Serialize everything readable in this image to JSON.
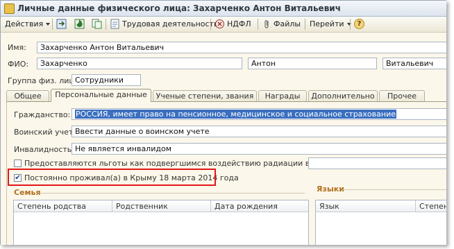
{
  "window": {
    "title": "Личные данные физического лица: Захарченко Антон Витальевич"
  },
  "toolbar": {
    "actions_label": "Действия",
    "labor_label": "Трудовая деятельность",
    "ndfl_label": "НДФЛ",
    "files_label": "Файлы",
    "goto_label": "Перейти",
    "help_label": "?"
  },
  "form": {
    "name_label": "Имя:",
    "name_value": "Захарченко Антон Витальевич",
    "fio_label": "ФИО:",
    "last_name": "Захарченко",
    "first_name": "Антон",
    "middle_name": "Витальевич",
    "group_label": "Группа физ. лиц:",
    "group_value": "Сотрудники"
  },
  "tabs": [
    "Общее",
    "Персональные данные",
    "Ученые степени, звания",
    "Награды",
    "Дополнительно",
    "Прочее"
  ],
  "personal": {
    "citizenship_label": "Гражданство:",
    "citizenship_value": "РОССИЯ, имеет право на пенсионное, медицинское и социальное страхование",
    "military_label": "Воинский учет:",
    "military_value": "Ввести данные о воинском учете",
    "disability_label": "Инвалидность:",
    "disability_value": "Не является инвалидом",
    "radiation_label": "Предоставляются льготы как подвергшимся воздействию радиации в связи с:",
    "radiation_checked": false,
    "crimea_label": "Постоянно проживал(а) в Крыму 18 марта 2014 года",
    "crimea_checked": true,
    "checkmark": "✔"
  },
  "family": {
    "title": "Семья",
    "columns": [
      "Степень родства",
      "Родственник",
      "Дата рождения"
    ]
  },
  "languages": {
    "title": "Языки",
    "columns": [
      "Язык",
      "Степень"
    ]
  },
  "colors": {
    "highlight": "#3a6fc0",
    "section": "#b2701e",
    "annotation": "#e01818"
  }
}
